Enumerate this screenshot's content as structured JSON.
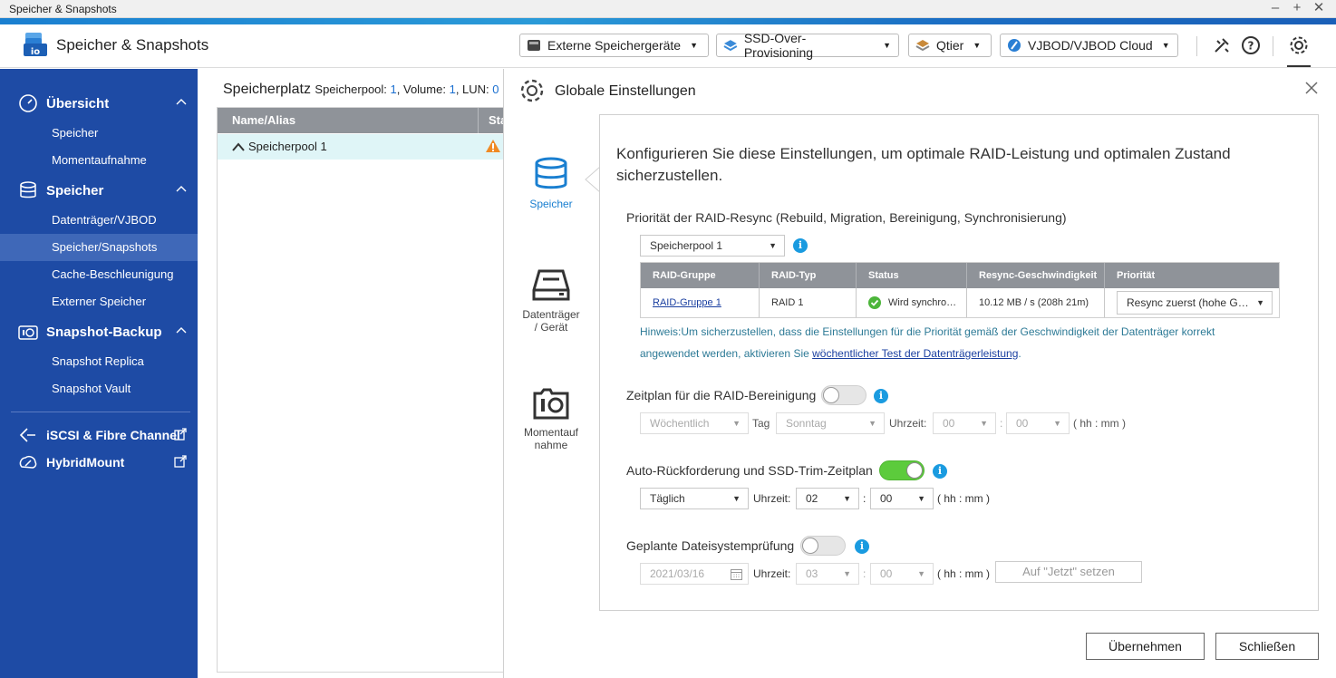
{
  "window": {
    "title": "Speicher & Snapshots"
  },
  "header": {
    "app_title": "Speicher & Snapshots",
    "buttons": [
      {
        "label": "Externe Speichergeräte",
        "icon": "external-storage-icon"
      },
      {
        "label": "SSD-Over-Provisioning",
        "icon": "ssd-icon"
      },
      {
        "label": "Qtier",
        "icon": "qtier-icon"
      },
      {
        "label": "VJBOD/VJBOD Cloud",
        "icon": "vjbod-icon"
      }
    ],
    "icons": [
      "tools-icon",
      "help-icon",
      "settings-icon"
    ]
  },
  "sidebar": {
    "groups": [
      {
        "label": "Übersicht",
        "icon": "dashboard-icon",
        "items": [
          "Speicher",
          "Momentaufnahme"
        ]
      },
      {
        "label": "Speicher",
        "icon": "database-icon",
        "items": [
          "Datenträger/VJBOD",
          "Speicher/Snapshots",
          "Cache-Beschleunigung",
          "Externer Speicher"
        ]
      },
      {
        "label": "Snapshot-Backup",
        "icon": "camera-icon",
        "items": [
          "Snapshot Replica",
          "Snapshot Vault"
        ]
      }
    ],
    "links": [
      {
        "label": "iSCSI & Fibre Channel",
        "icon": "iscsi-icon"
      },
      {
        "label": "HybridMount",
        "icon": "hybridmount-icon"
      }
    ],
    "active_item": "Speicher/Snapshots"
  },
  "main": {
    "title": "Speicherplatz",
    "summary": {
      "pool_label": "Speicherpool:",
      "pool_count": "1",
      "volume_label": ", Volume:",
      "volume_count": "1",
      "lun_label": ", LUN:",
      "lun_count": "0"
    },
    "columns": [
      "Name/Alias",
      "Status"
    ],
    "rows": [
      {
        "name": "Speicherpool 1",
        "status_icon": "warning-icon"
      }
    ]
  },
  "dialog": {
    "title": "Globale Einstellungen",
    "tabs": [
      {
        "label": "Speicher",
        "icon": "database-icon",
        "active": true
      },
      {
        "label": "Datenträger / Gerät",
        "line1": "Datenträger",
        "line2": "/ Gerät",
        "icon": "disk-icon"
      },
      {
        "label": "Momentaufnahme",
        "line1": "Momentauf",
        "line2": "nahme",
        "icon": "snapshot-icon"
      }
    ],
    "intro": "Konfigurieren Sie diese Einstellungen, um optimale RAID-Leistung und optimalen Zustand sicherzustellen.",
    "resync": {
      "title": "Priorität der RAID-Resync (Rebuild, Migration, Bereinigung, Synchronisierung)",
      "pool_select": "Speicherpool 1",
      "columns": [
        "RAID-Gruppe",
        "RAID-Typ",
        "Status",
        "Resync-Geschwindigkeit",
        "Priorität"
      ],
      "rows": [
        {
          "group": "RAID-Gruppe 1",
          "type": "RAID 1",
          "status": "Wird synchro…",
          "speed": "10.12 MB / s (208h 21m)",
          "priority": "Resync zuerst (hohe G…"
        }
      ],
      "hint_prefix": "Hinweis:Um sicherzustellen, dass die Einstellungen für die Priorität gemäß der Geschwindigkeit der Datenträger korrekt angewendet werden, aktivieren Sie ",
      "hint_link": "wöchentlicher Test der Datenträgerleistung",
      "hint_suffix": "."
    },
    "scrub": {
      "title": "Zeitplan für die RAID-Bereinigung",
      "enabled": false,
      "frequency": "Wöchentlich",
      "day_label": "Tag",
      "day": "Sonntag",
      "time_label": "Uhrzeit:",
      "hour": "00",
      "minute": "00",
      "format": "( hh : mm )"
    },
    "trim": {
      "title": "Auto-Rückforderung und SSD-Trim-Zeitplan",
      "enabled": true,
      "frequency": "Täglich",
      "time_label": "Uhrzeit:",
      "hour": "02",
      "minute": "00",
      "format": "( hh : mm )"
    },
    "fscheck": {
      "title": "Geplante Dateisystemprüfung",
      "enabled": false,
      "date": "2021/03/16",
      "time_label": "Uhrzeit:",
      "hour": "03",
      "minute": "00",
      "format": "( hh : mm )",
      "set_now": "Auf \"Jetzt\" setzen"
    },
    "colon": ":",
    "apply": "Übernehmen",
    "close": "Schließen"
  }
}
